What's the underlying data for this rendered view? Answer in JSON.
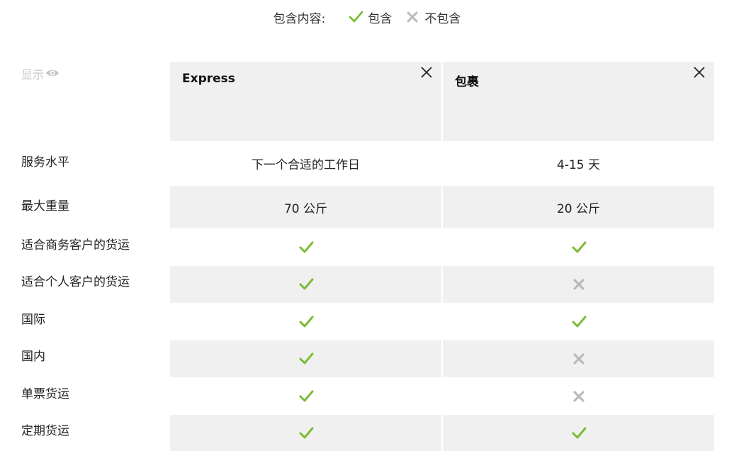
{
  "legend": {
    "title": "包含内容:",
    "included_label": "包含",
    "excluded_label": "不包含",
    "included_icon": "check-icon",
    "excluded_icon": "cross-icon",
    "check_color": "#7dbb35",
    "cross_color": "#b9b9b9"
  },
  "show_toggle": {
    "label": "显示",
    "icon": "eye-icon"
  },
  "columns": [
    {
      "name": "Express",
      "close_icon": "close-icon"
    },
    {
      "name": "包裹",
      "close_icon": "close-icon"
    }
  ],
  "rows": [
    {
      "label": "服务水平",
      "values": [
        "下一个合适的工作日",
        "4-15 天"
      ]
    },
    {
      "label": "最大重量",
      "values": [
        "70 公斤",
        "20 公斤"
      ]
    },
    {
      "label": "适合商务客户的货运",
      "values": [
        true,
        true
      ]
    },
    {
      "label": "适合个人客户的货运",
      "values": [
        true,
        false
      ]
    },
    {
      "label": "国际",
      "values": [
        true,
        true
      ]
    },
    {
      "label": "国内",
      "values": [
        true,
        false
      ]
    },
    {
      "label": "单票货运",
      "values": [
        true,
        false
      ]
    },
    {
      "label": "定期货运",
      "values": [
        true,
        true
      ]
    }
  ]
}
